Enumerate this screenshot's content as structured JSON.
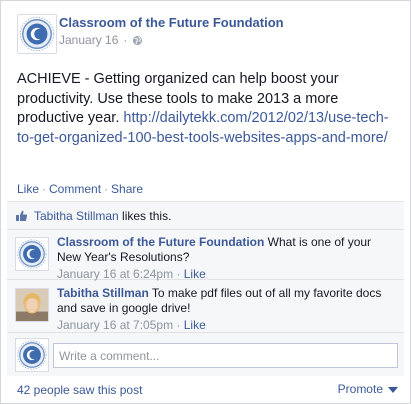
{
  "post": {
    "page_name": "Classroom of the Future Foundation",
    "date": "January 16",
    "audience_icon": "globe-icon",
    "text": "ACHIEVE - Getting organized can help boost your productivity. Use these tools to make 2013 a more productive year. ",
    "link": "http://dailytekk.com/2012/02/13/use-tech-to-get-organized-100-best-tools-websites-apps-and-more/"
  },
  "actions": {
    "like": "Like",
    "comment": "Comment",
    "share": "Share",
    "separator": "·"
  },
  "likes": {
    "icon": "thumbs-up-icon",
    "liker": "Tabitha Stillman",
    "suffix": " likes this."
  },
  "comments": [
    {
      "author": "Classroom of the Future Foundation",
      "text": " What is one of your New Year's Resolutions?",
      "timestamp": "January 16 at 6:24pm",
      "like_label": "Like"
    },
    {
      "author": "Tabitha Stillman",
      "text": " To make pdf files out of all my favorite docs and save in google drive!",
      "timestamp": "January 16 at 7:05pm",
      "like_label": "Like"
    }
  ],
  "composer": {
    "placeholder": "Write a comment..."
  },
  "footer": {
    "seen": "42 people saw this post",
    "promote": "Promote"
  },
  "colors": {
    "link": "#3b5998",
    "muted": "#8c93a0",
    "ufi_background": "#f6f7f9"
  }
}
